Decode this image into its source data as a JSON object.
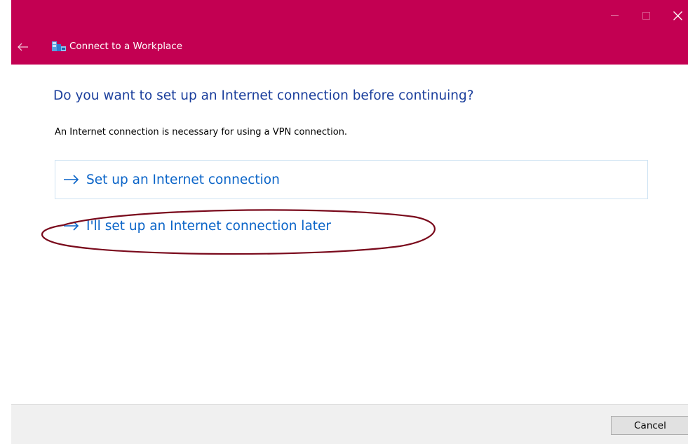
{
  "window": {
    "title": "Connect to a Workplace",
    "controls": {
      "minimize_icon": "minimize-icon",
      "maximize_icon": "maximize-icon",
      "close_icon": "close-icon"
    },
    "titlebar_color": "#c30052"
  },
  "main": {
    "heading": "Do you want to set up an Internet connection before continuing?",
    "subtext": "An Internet connection is necessary for using a VPN connection.",
    "options": [
      {
        "label": "Set up an Internet connection",
        "icon": "arrow-right-icon"
      },
      {
        "label": "I'll set up an Internet connection later",
        "icon": "arrow-right-icon"
      }
    ],
    "link_color": "#0a64c8",
    "heading_color": "#1a3e9c",
    "annotation_color": "#7a0a1c"
  },
  "footer": {
    "cancel_label": "Cancel"
  }
}
